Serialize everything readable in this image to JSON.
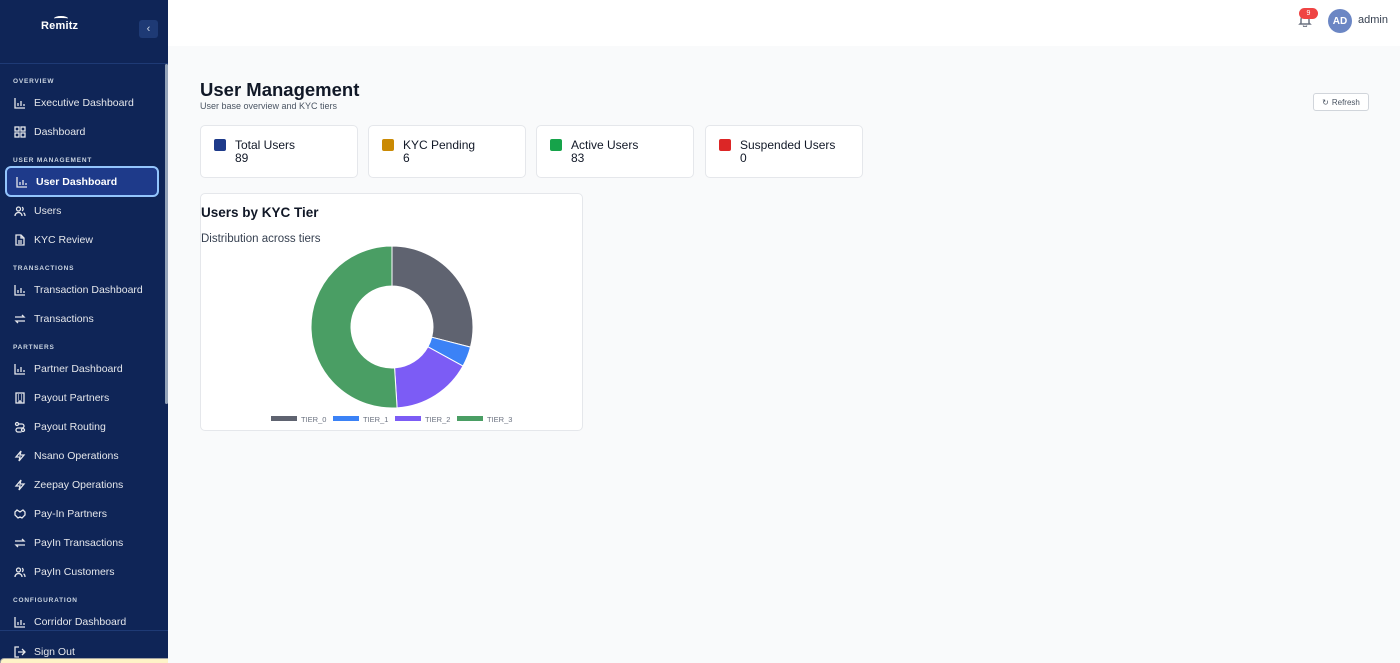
{
  "sidebar": {
    "logo_text": "Remitz",
    "collapse_icon": "chevron-left-icon",
    "sections": {
      "overview": "Overview",
      "user_management": "User Management",
      "transactions": "Transactions",
      "partners": "Partners",
      "configuration": "Configuration"
    },
    "items": {
      "executive_dashboard": "Executive Dashboard",
      "dashboard": "Dashboard",
      "user_dashboard": "User Dashboard",
      "users": "Users",
      "kyc_review": "KYC Review",
      "transaction_dashboard": "Transaction Dashboard",
      "transactions": "Transactions",
      "partner_dashboard": "Partner Dashboard",
      "payout_partners": "Payout Partners",
      "payout_routing": "Payout Routing",
      "nsano_operations": "Nsano Operations",
      "zeepay_operations": "Zeepay Operations",
      "pay_in_partners": "Pay-In Partners",
      "payin_transactions": "PayIn Transactions",
      "payin_customers": "PayIn Customers",
      "corridor_dashboard": "Corridor Dashboard",
      "sign_out": "Sign Out"
    },
    "active_item": "User Dashboard"
  },
  "topbar": {
    "notification_count": "9",
    "avatar_initials": "AD",
    "username": "admin"
  },
  "page": {
    "title": "User Management",
    "subtitle": "User base overview and KYC tiers",
    "refresh_label": "Refresh"
  },
  "stats": [
    {
      "label": "Total Users",
      "value": "89",
      "color": "#1e3a8a"
    },
    {
      "label": "KYC Pending",
      "value": "6",
      "color": "#ca8a04"
    },
    {
      "label": "Active Users",
      "value": "83",
      "color": "#16a34a"
    },
    {
      "label": "Suspended Users",
      "value": "0",
      "color": "#dc2626"
    }
  ],
  "chart": {
    "title": "Users by KYC Tier",
    "subtitle": "Distribution across tiers"
  },
  "chart_data": {
    "type": "pie",
    "donut": true,
    "categories": [
      "TIER_0",
      "TIER_1",
      "TIER_2",
      "TIER_3"
    ],
    "values": [
      29,
      4,
      16,
      51
    ],
    "colors": [
      "#5f6370",
      "#3b82f6",
      "#7c5cf5",
      "#4a9e64"
    ],
    "legend_position": "bottom",
    "title": "Users by KYC Tier",
    "subtitle": "Distribution across tiers"
  }
}
